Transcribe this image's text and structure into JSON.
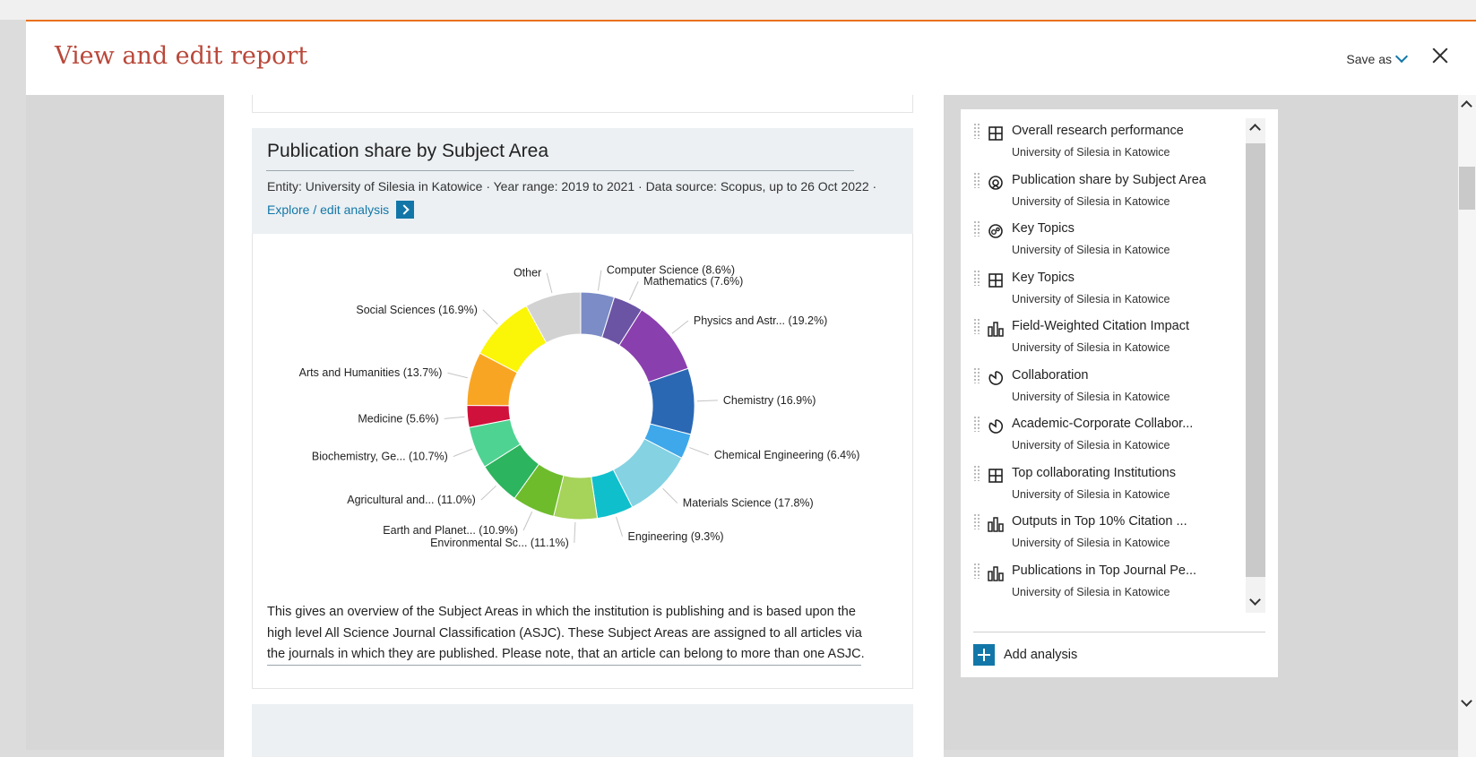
{
  "modal": {
    "title": "View and edit report",
    "save_as_label": "Save as"
  },
  "card": {
    "title": "Publication share by Subject Area",
    "meta": "Entity: University of Silesia in Katowice  ·  Year range: 2019 to 2021 ·  Data source: Scopus, up to 26 Oct 2022 ·",
    "explore_label": "Explore / edit analysis",
    "description": "This gives an overview of the Subject Areas in which the institution is publishing and is based upon the high level All Science Journal Classification (ASJC). These Subject Areas are assigned to all articles via the journals in which they are published. Please note, that an article can belong to more than one ASJC."
  },
  "chart_data": {
    "type": "pie",
    "variant": "donut",
    "slices": [
      {
        "label": "Computer Science (8.6%)",
        "value": 8.6,
        "color": "#7b8cc7"
      },
      {
        "label": "Mathematics (7.6%)",
        "value": 7.6,
        "color": "#6b54a4"
      },
      {
        "label": "Physics and Astr... (19.2%)",
        "value": 19.2,
        "color": "#8a3fae"
      },
      {
        "label": "Chemistry (16.9%)",
        "value": 16.9,
        "color": "#2a68b4"
      },
      {
        "label": "Chemical Engineering (6.4%)",
        "value": 6.4,
        "color": "#3ea8ea"
      },
      {
        "label": "Materials Science (17.8%)",
        "value": 17.8,
        "color": "#84d2e2"
      },
      {
        "label": "Engineering (9.3%)",
        "value": 9.3,
        "color": "#10bfcc"
      },
      {
        "label": "Environmental Sc... (11.1%)",
        "value": 11.1,
        "color": "#a6d35a"
      },
      {
        "label": "Earth and Planet... (10.9%)",
        "value": 10.9,
        "color": "#6ebc2c"
      },
      {
        "label": "Agricultural and... (11.0%)",
        "value": 11.0,
        "color": "#2db45e"
      },
      {
        "label": "Biochemistry, Ge... (10.7%)",
        "value": 10.7,
        "color": "#4fd392"
      },
      {
        "label": "Medicine (5.6%)",
        "value": 5.6,
        "color": "#d0113b"
      },
      {
        "label": "Arts and Humanities (13.7%)",
        "value": 13.7,
        "color": "#f9a524"
      },
      {
        "label": "Social Sciences (16.9%)",
        "value": 16.9,
        "color": "#fbf508"
      },
      {
        "label": "Other",
        "value": 14.3,
        "color": "#d2d2d2"
      }
    ]
  },
  "panel": {
    "items": [
      {
        "title": "Overall research performance",
        "subtitle": "University of Silesia in Katowice",
        "icon": "table-icon"
      },
      {
        "title": "Publication share by Subject Area",
        "subtitle": "University of Silesia in Katowice",
        "icon": "donut-icon"
      },
      {
        "title": "Key Topics",
        "subtitle": "University of Silesia in Katowice",
        "icon": "bubble-icon"
      },
      {
        "title": "Key Topics",
        "subtitle": "University of Silesia in Katowice",
        "icon": "table-icon"
      },
      {
        "title": "Field-Weighted Citation Impact",
        "subtitle": "University of Silesia in Katowice",
        "icon": "bar-chart-icon"
      },
      {
        "title": "Collaboration",
        "subtitle": "University of Silesia in Katowice",
        "icon": "pie-icon"
      },
      {
        "title": "Academic-Corporate Collabor...",
        "subtitle": "University of Silesia in Katowice",
        "icon": "pie-icon"
      },
      {
        "title": "Top collaborating Institutions",
        "subtitle": "University of Silesia in Katowice",
        "icon": "table-icon"
      },
      {
        "title": "Outputs in Top 10% Citation ...",
        "subtitle": "University of Silesia in Katowice",
        "icon": "bar-chart-icon"
      },
      {
        "title": "Publications in Top Journal Pe...",
        "subtitle": "University of Silesia in Katowice",
        "icon": "bar-chart-icon"
      }
    ],
    "add_label": "Add analysis"
  },
  "colors": {
    "title": "#b9483a",
    "accent": "#1277a8",
    "header_rule": "#e9711c"
  }
}
